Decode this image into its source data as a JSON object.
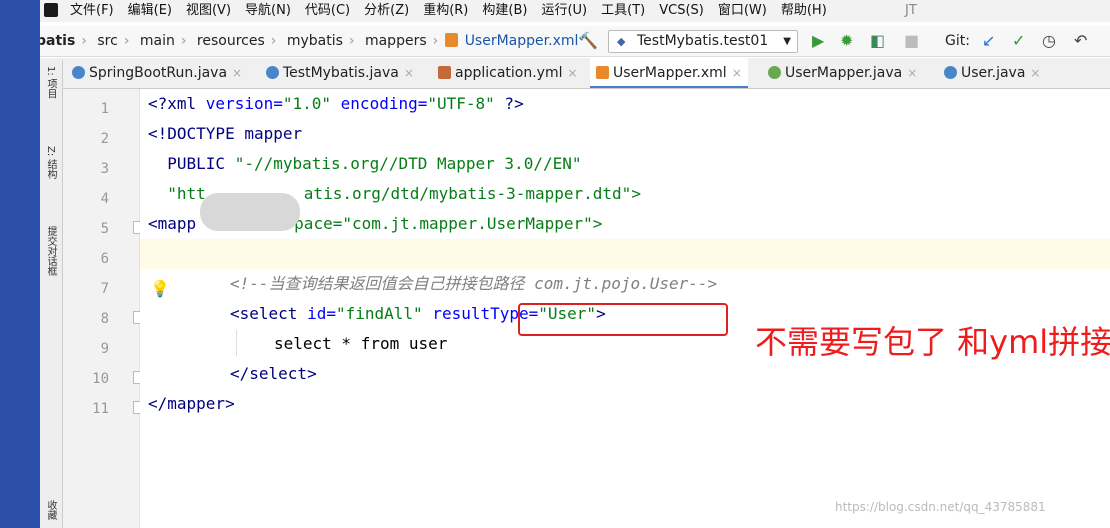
{
  "menu": [
    "文件(F)",
    "编辑(E)",
    "视图(V)",
    "导航(N)",
    "代码(C)",
    "分析(Z)",
    "重构(R)",
    "构建(B)",
    "运行(U)",
    "工具(T)",
    "VCS(S)",
    "窗口(W)",
    "帮助(H)"
  ],
  "window_title": "JT",
  "breadcrumb": [
    "batis",
    "src",
    "main",
    "resources",
    "mybatis",
    "mappers",
    "UserMapper.xml"
  ],
  "run_config": "TestMybatis.test01",
  "git_label": "Git:",
  "tabs": [
    {
      "label": "SpringBootRun.java",
      "color": "#4a86c7"
    },
    {
      "label": "TestMybatis.java",
      "color": "#4a86c7"
    },
    {
      "label": "application.yml",
      "color": "#c46a3a"
    },
    {
      "label": "UserMapper.xml",
      "color": "#e88a2b"
    },
    {
      "label": "UserMapper.java",
      "color": "#6aa84f"
    },
    {
      "label": "User.java",
      "color": "#4a86c7"
    }
  ],
  "side_panels": [
    "1: 项目",
    "Z: 结构",
    "提交对话框",
    "收藏"
  ],
  "line_numbers": [
    "1",
    "2",
    "3",
    "4",
    "5",
    "6",
    "7",
    "8",
    "9",
    "10",
    "11"
  ],
  "code": {
    "l1": [
      "<?xml ",
      "version=",
      "\"1.0\"",
      " encoding=",
      "\"UTF-8\"",
      " ?>"
    ],
    "l2": [
      "<!DOCTYPE mapper"
    ],
    "l3": [
      "  PUBLIC ",
      "\"-//mybatis.org//DTD Mapper 3.0//EN\""
    ],
    "l4": [
      "  \"htt",
      "atis.org/dtd/mybatis-3-mapper.dtd\">"
    ],
    "l5": [
      "<mapp",
      "pace=\"com.jt.mapper.UserMapper\">"
    ],
    "l7": [
      "<!--当查询结果返回值会自己拼接包路径 com.jt.pojo.User-->"
    ],
    "l8": [
      "<select ",
      "id=",
      "\"findAll\"",
      " resultType=",
      "\"User\"",
      ">"
    ],
    "l9": [
      "select * from user"
    ],
    "l10": [
      "</select>"
    ],
    "l11": [
      "</mapper>"
    ]
  },
  "annotation": "不需要写包了 和yml拼接",
  "watermark": "https://blog.csdn.net/qq_43785881",
  "colors": {
    "accent": "#4a7dc7",
    "annotation_red": "#ee1c1c"
  }
}
